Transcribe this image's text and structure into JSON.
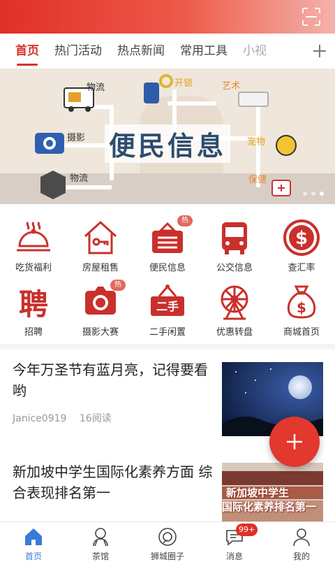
{
  "header": {
    "scan_icon": "scan-icon",
    "background_color": "#e02f28"
  },
  "tabs": [
    {
      "label": "首页",
      "active": true
    },
    {
      "label": "热门活动"
    },
    {
      "label": "热点新闻"
    },
    {
      "label": "常用工具"
    },
    {
      "label": "小视"
    }
  ],
  "tabs_add_icon": "plus-icon",
  "banner": {
    "title": "便民信息",
    "labels": {
      "wuliu1": "物流",
      "kaisuo": "开锁",
      "yishu": "艺术",
      "sheying": "摄影",
      "chongwu": "宠物",
      "wuliu2": "物流",
      "baojian": "保健"
    },
    "slide_count": 3,
    "active_slide": 3
  },
  "grid": [
    {
      "label": "吃货福利",
      "icon": "food-cloche-icon"
    },
    {
      "label": "房屋租售",
      "icon": "house-key-icon"
    },
    {
      "label": "便民信息",
      "icon": "info-board-icon",
      "badge": "热"
    },
    {
      "label": "公交信息",
      "icon": "bus-icon"
    },
    {
      "label": "查汇率",
      "icon": "dollar-coin-icon"
    },
    {
      "label": "招聘",
      "icon": "recruit-icon",
      "glyph": "聘"
    },
    {
      "label": "摄影大赛",
      "icon": "camera-icon",
      "badge": "热"
    },
    {
      "label": "二手闲置",
      "icon": "secondhand-sign-icon",
      "glyph": "二手"
    },
    {
      "label": "优惠转盘",
      "icon": "ferris-wheel-icon"
    },
    {
      "label": "商城首页",
      "icon": "money-bag-icon"
    }
  ],
  "articles": [
    {
      "title": "今年万圣节有蓝月亮，记得要看哟",
      "author": "Janice0919",
      "reads": "16阅读"
    },
    {
      "title": "新加坡中学生国际化素养方面 综合表现排名第一",
      "thumb_text_1": "新加坡中学生",
      "thumb_text_2": "国际化素养排名第一"
    }
  ],
  "fab": {
    "icon": "plus-icon",
    "color": "#e2382e"
  },
  "tabbar": [
    {
      "label": "首页",
      "icon": "home-icon",
      "active": true
    },
    {
      "label": "茶馆",
      "icon": "teahouse-icon"
    },
    {
      "label": "狮城圈子",
      "icon": "circle-icon"
    },
    {
      "label": "消息",
      "icon": "message-icon",
      "badge": "99+"
    },
    {
      "label": "我的",
      "icon": "profile-icon"
    }
  ]
}
